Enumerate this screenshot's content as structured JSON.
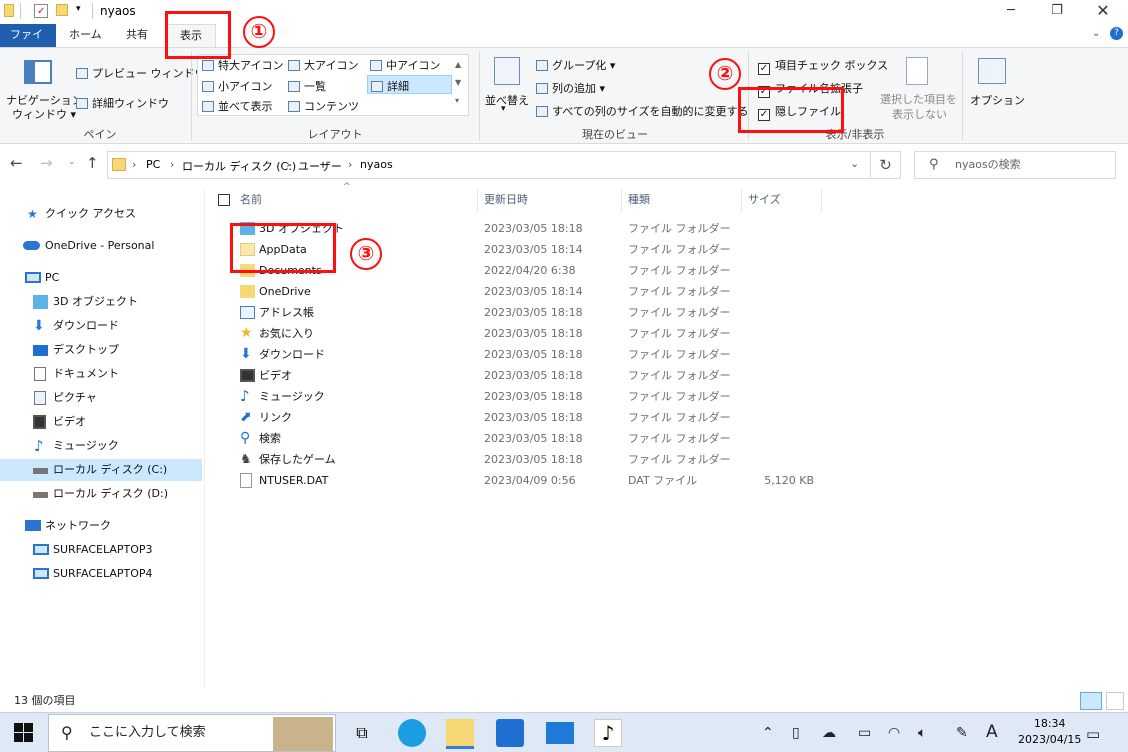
{
  "window": {
    "title": "nyaos"
  },
  "ribbon_tabs": [
    "ファイル",
    "ホーム",
    "共有",
    "表示"
  ],
  "ribbon": {
    "pane_group": {
      "nav_pane_line1": "ナビゲーション",
      "nav_pane_line2": "ウィンドウ",
      "preview": "プレビュー ウィンドウ",
      "details_pane": "詳細ウィンドウ",
      "label": "ペイン"
    },
    "layout_group": {
      "items": [
        "特大アイコン",
        "大アイコン",
        "中アイコン",
        "小アイコン",
        "一覧",
        "詳細",
        "並べて表示",
        "コンテンツ"
      ],
      "label": "レイアウト"
    },
    "current_view_group": {
      "sort": "並べ替え",
      "group_by": "グループ化",
      "add_columns": "列の追加",
      "fit_columns": "すべての列のサイズを自動的に変更する",
      "label": "現在のビュー"
    },
    "show_hide_group": {
      "item_checkboxes": "項目チェック ボックス",
      "file_extensions": "ファイル名拡張子",
      "hidden_items": "隠しファイル",
      "hide_selected_line1": "選択した項目を",
      "hide_selected_line2": "表示しない",
      "label": "表示/非表示"
    },
    "options": "オプション"
  },
  "address": {
    "crumbs": [
      "PC",
      "ローカル ディスク (C:)",
      "ユーザー",
      "nyaos"
    ],
    "search_placeholder": "nyaosの検索"
  },
  "nav": {
    "quick_access": "クイック アクセス",
    "onedrive": "OneDrive - Personal",
    "pc": "PC",
    "pc_items": [
      "3D オブジェクト",
      "ダウンロード",
      "デスクトップ",
      "ドキュメント",
      "ピクチャ",
      "ビデオ",
      "ミュージック",
      "ローカル ディスク (C:)",
      "ローカル ディスク (D:)"
    ],
    "network": "ネットワーク",
    "network_items": [
      "SURFACELAPTOP3",
      "SURFACELAPTOP4"
    ]
  },
  "columns": {
    "name": "名前",
    "date": "更新日時",
    "type": "種類",
    "size": "サイズ"
  },
  "files": [
    {
      "name": "3D オブジェクト",
      "date": "2023/03/05 18:18",
      "type": "ファイル フォルダー",
      "size": ""
    },
    {
      "name": "AppData",
      "date": "2023/03/05 18:14",
      "type": "ファイル フォルダー",
      "size": ""
    },
    {
      "name": "Documents",
      "date": "2022/04/20 6:38",
      "type": "ファイル フォルダー",
      "size": ""
    },
    {
      "name": "OneDrive",
      "date": "2023/03/05 18:14",
      "type": "ファイル フォルダー",
      "size": ""
    },
    {
      "name": "アドレス帳",
      "date": "2023/03/05 18:18",
      "type": "ファイル フォルダー",
      "size": ""
    },
    {
      "name": "お気に入り",
      "date": "2023/03/05 18:18",
      "type": "ファイル フォルダー",
      "size": ""
    },
    {
      "name": "ダウンロード",
      "date": "2023/03/05 18:18",
      "type": "ファイル フォルダー",
      "size": ""
    },
    {
      "name": "ビデオ",
      "date": "2023/03/05 18:18",
      "type": "ファイル フォルダー",
      "size": ""
    },
    {
      "name": "ミュージック",
      "date": "2023/03/05 18:18",
      "type": "ファイル フォルダー",
      "size": ""
    },
    {
      "name": "リンク",
      "date": "2023/03/05 18:18",
      "type": "ファイル フォルダー",
      "size": ""
    },
    {
      "name": "検索",
      "date": "2023/03/05 18:18",
      "type": "ファイル フォルダー",
      "size": ""
    },
    {
      "name": "保存したゲーム",
      "date": "2023/03/05 18:18",
      "type": "ファイル フォルダー",
      "size": ""
    },
    {
      "name": "NTUSER.DAT",
      "date": "2023/04/09 0:56",
      "type": "DAT ファイル",
      "size": "5,120 KB"
    }
  ],
  "status": {
    "item_count": "13 個の項目"
  },
  "annotations": [
    "①",
    "②",
    "③"
  ],
  "taskbar": {
    "search_placeholder": "ここに入力して検索",
    "time": "18:34",
    "date": "2023/04/15",
    "ime": "A"
  },
  "colors": {
    "file_tab": "#1f5fae",
    "annotation": "#ff1010",
    "selection": "#cce8ff"
  }
}
